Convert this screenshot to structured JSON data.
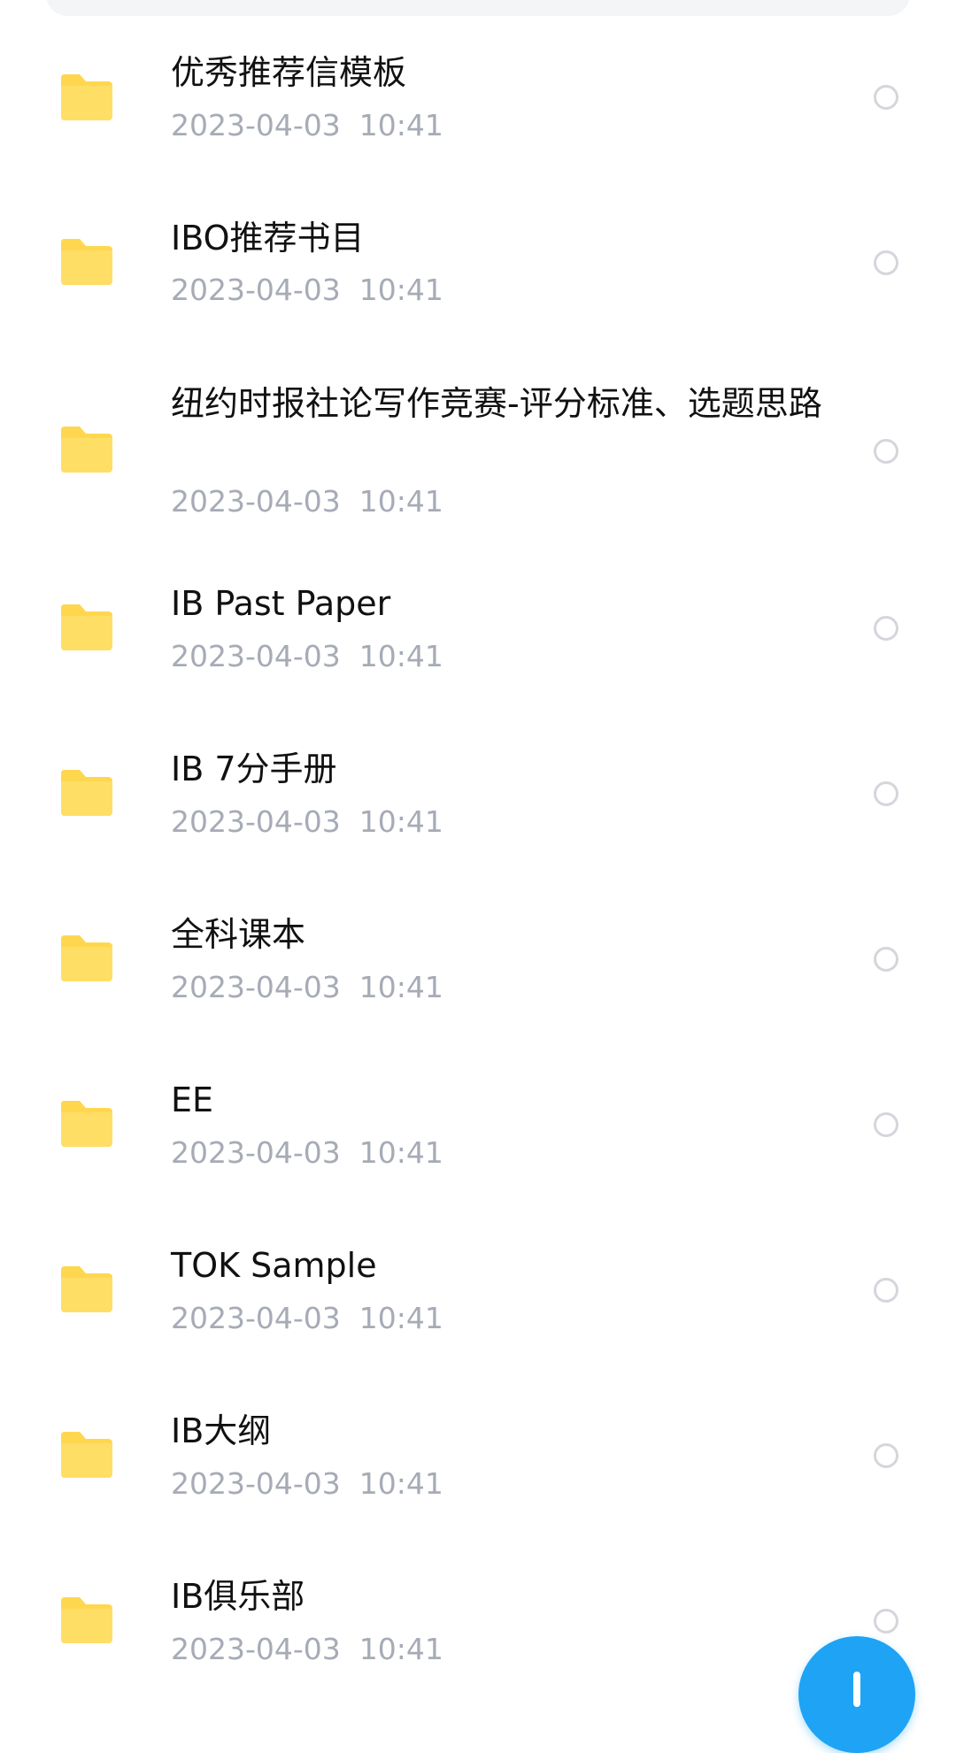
{
  "accent_color": "#1fa3f5",
  "folder_color": "#ffd74f",
  "files": [
    {
      "name": "优秀推荐信模板",
      "date": "2023-04-03",
      "time": "10:41",
      "icon": "folder-icon"
    },
    {
      "name": "IBO推荐书目",
      "date": "2023-04-03",
      "time": "10:41",
      "icon": "folder-icon"
    },
    {
      "name": "纽约时报社论写作竞赛-评分标准、选题思路",
      "date": "2023-04-03",
      "time": "10:41",
      "icon": "folder-icon"
    },
    {
      "name": "IB Past Paper",
      "date": "2023-04-03",
      "time": "10:41",
      "icon": "folder-icon"
    },
    {
      "name": "IB 7分手册",
      "date": "2023-04-03",
      "time": "10:41",
      "icon": "folder-icon"
    },
    {
      "name": "全科课本",
      "date": "2023-04-03",
      "time": "10:41",
      "icon": "folder-icon"
    },
    {
      "name": "EE",
      "date": "2023-04-03",
      "time": "10:41",
      "icon": "folder-icon"
    },
    {
      "name": "TOK Sample",
      "date": "2023-04-03",
      "time": "10:41",
      "icon": "folder-icon"
    },
    {
      "name": "IB大纲",
      "date": "2023-04-03",
      "time": "10:41",
      "icon": "folder-icon"
    },
    {
      "name": "IB俱乐部",
      "date": "2023-04-03",
      "time": "10:41",
      "icon": "folder-icon"
    }
  ],
  "fab_icon": "plus-icon"
}
